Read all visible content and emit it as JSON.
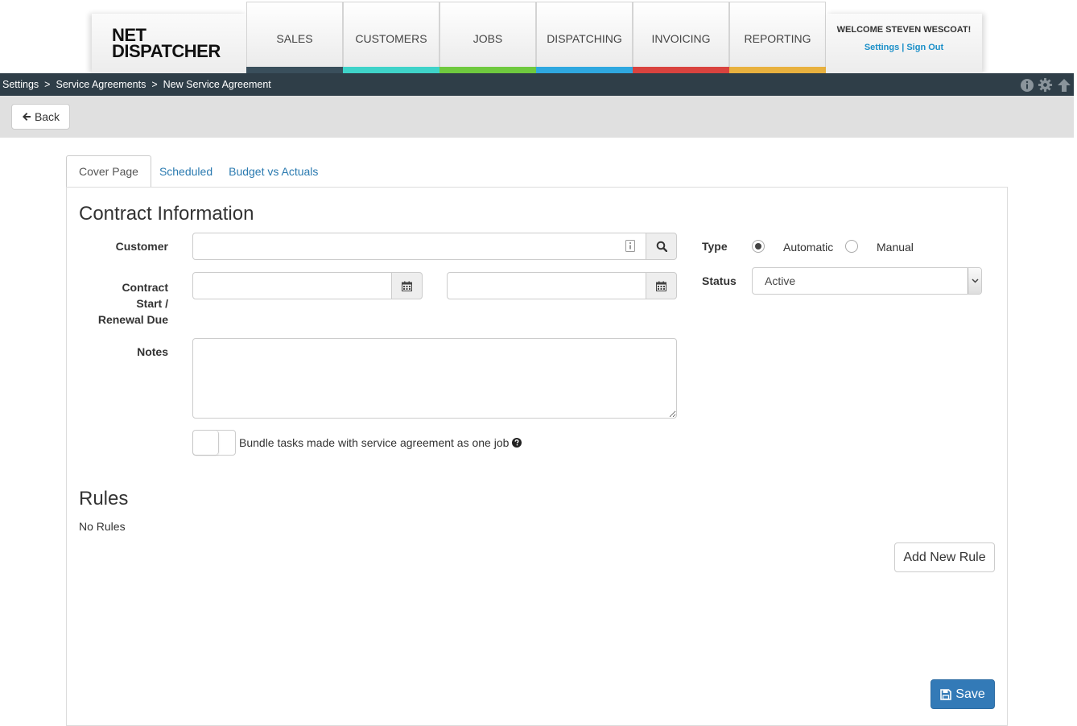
{
  "logo": {
    "line1": "NET",
    "line2": "DISPATCHER"
  },
  "nav": [
    {
      "label": "SALES",
      "color": "#3a4f5c"
    },
    {
      "label": "CUSTOMERS",
      "color": "#3fd3c9"
    },
    {
      "label": "JOBS",
      "color": "#6fc93f"
    },
    {
      "label": "DISPATCHING",
      "color": "#2fa8e0"
    },
    {
      "label": "INVOICING",
      "color": "#d9433f"
    },
    {
      "label": "REPORTING",
      "color": "#e8b13f"
    }
  ],
  "welcome": {
    "text": "WELCOME STEVEN WESCOAT!",
    "settings": "Settings",
    "separator": "|",
    "signout": "Sign Out"
  },
  "breadcrumb": {
    "items": [
      "Settings",
      "Service Agreements",
      "New Service Agreement"
    ],
    "separator": ">"
  },
  "toolbar": {
    "back_label": "Back"
  },
  "tabs": [
    "Cover Page",
    "Scheduled",
    "Budget vs Actuals"
  ],
  "contract": {
    "title": "Contract Information",
    "customer_label": "Customer",
    "customer_value": "",
    "start_label_1": "Contract",
    "start_label_2": "Start /",
    "start_label_3": "Renewal Due",
    "start_value": "",
    "renewal_value": "",
    "notes_label": "Notes",
    "notes_value": "",
    "bundle_label": "Bundle tasks made with service agreement as one job",
    "type_label": "Type",
    "type_options": [
      "Automatic",
      "Manual"
    ],
    "type_selected": "Automatic",
    "status_label": "Status",
    "status_value": "Active"
  },
  "rules": {
    "title": "Rules",
    "empty_text": "No Rules",
    "add_label": "Add New Rule"
  },
  "save_label": "Save",
  "icons": {
    "info": "info-icon",
    "settings": "gear-icon",
    "up": "arrow-up-icon",
    "back": "arrow-left-icon",
    "search": "search-icon",
    "calendar": "calendar-icon",
    "save": "floppy-disk-icon",
    "help": "question-circle-icon",
    "contact": "contact-card-icon"
  }
}
